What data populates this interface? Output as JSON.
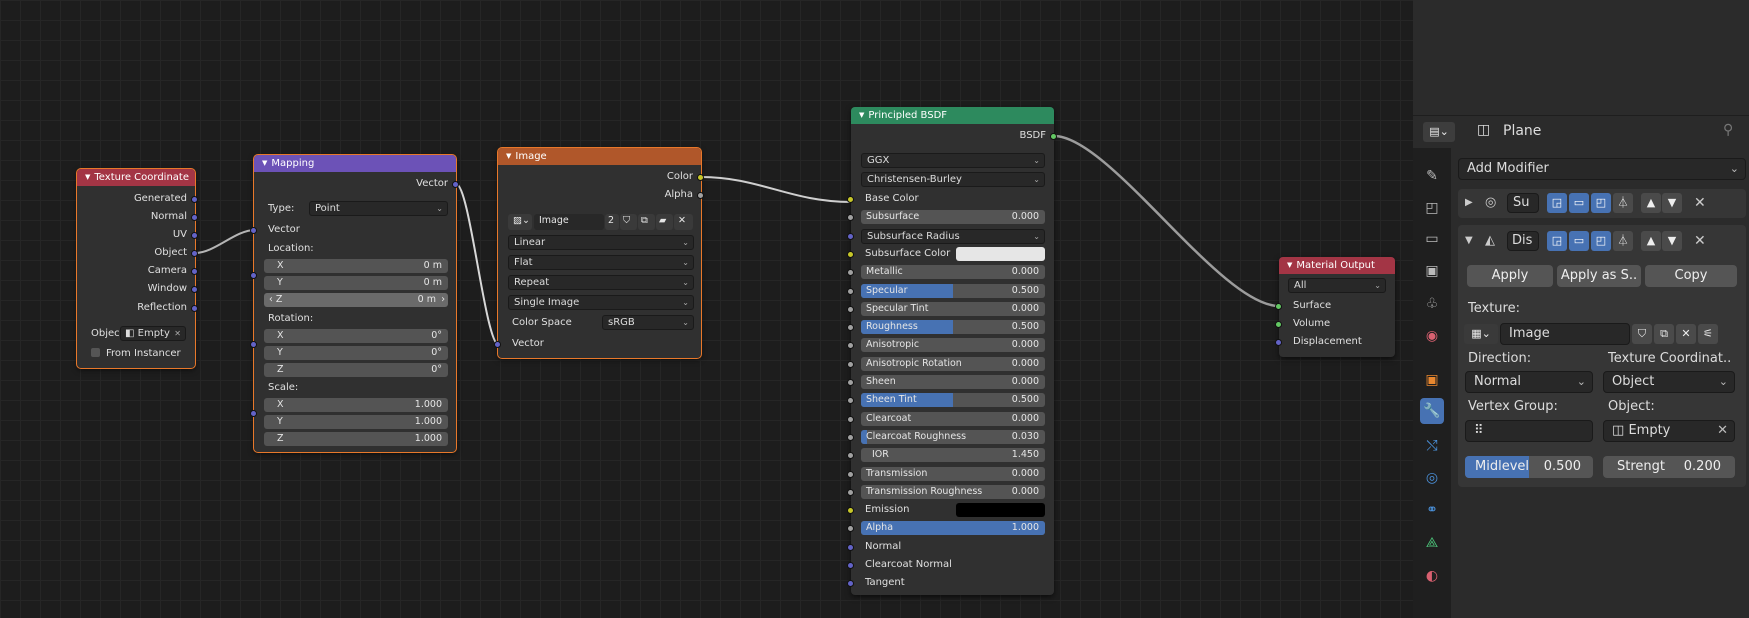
{
  "nodes": {
    "texcoord": {
      "title": "Texture Coordinate",
      "outputs": [
        "Generated",
        "Normal",
        "UV",
        "Object",
        "Camera",
        "Window",
        "Reflection"
      ],
      "object_label": "Objec",
      "object_value": "Empty",
      "from_instancer": "From Instancer"
    },
    "mapping": {
      "title": "Mapping",
      "output": "Vector",
      "type_label": "Type:",
      "type_value": "Point",
      "vector": "Vector",
      "location": "Location:",
      "rotation": "Rotation:",
      "scale": "Scale:",
      "loc": [
        {
          "a": "X",
          "v": "0 m"
        },
        {
          "a": "Y",
          "v": "0 m"
        },
        {
          "a": "Z",
          "v": "0 m"
        }
      ],
      "rot": [
        {
          "a": "X",
          "v": "0°"
        },
        {
          "a": "Y",
          "v": "0°"
        },
        {
          "a": "Z",
          "v": "0°"
        }
      ],
      "scl": [
        {
          "a": "X",
          "v": "1.000"
        },
        {
          "a": "Y",
          "v": "1.000"
        },
        {
          "a": "Z",
          "v": "1.000"
        }
      ]
    },
    "image": {
      "title": "Image",
      "out_color": "Color",
      "out_alpha": "Alpha",
      "image_name": "Image",
      "users": "2",
      "interp": "Linear",
      "proj": "Flat",
      "ext": "Repeat",
      "source": "Single Image",
      "cs_label": "Color Space",
      "cs_value": "sRGB",
      "in_vector": "Vector"
    },
    "bsdf": {
      "title": "Principled BSDF",
      "output": "BSDF",
      "distribution": "GGX",
      "subsurface_method": "Christensen-Burley",
      "inputs": [
        {
          "label": "Base Color",
          "kind": "plain"
        },
        {
          "label": "Subsurface",
          "value": "0.000",
          "kind": "num"
        },
        {
          "label": "Subsurface Radius",
          "kind": "dd"
        },
        {
          "label": "Subsurface Color",
          "kind": "color",
          "color": "#e6e6e6"
        },
        {
          "label": "Metallic",
          "value": "0.000",
          "kind": "num"
        },
        {
          "label": "Specular",
          "value": "0.500",
          "kind": "num",
          "fill": 0.5
        },
        {
          "label": "Specular Tint",
          "value": "0.000",
          "kind": "num"
        },
        {
          "label": "Roughness",
          "value": "0.500",
          "kind": "num",
          "fill": 0.5
        },
        {
          "label": "Anisotropic",
          "value": "0.000",
          "kind": "num"
        },
        {
          "label": "Anisotropic Rotation",
          "value": "0.000",
          "kind": "num"
        },
        {
          "label": "Sheen",
          "value": "0.000",
          "kind": "num"
        },
        {
          "label": "Sheen Tint",
          "value": "0.500",
          "kind": "num",
          "fill": 0.5
        },
        {
          "label": "Clearcoat",
          "value": "0.000",
          "kind": "num"
        },
        {
          "label": "Clearcoat Roughness",
          "value": "0.030",
          "kind": "num",
          "fill": 0.03
        },
        {
          "label": "IOR",
          "value": "1.450",
          "kind": "num"
        },
        {
          "label": "Transmission",
          "value": "0.000",
          "kind": "num"
        },
        {
          "label": "Transmission Roughness",
          "value": "0.000",
          "kind": "num"
        },
        {
          "label": "Emission",
          "kind": "color",
          "color": "#000000"
        },
        {
          "label": "Alpha",
          "value": "1.000",
          "kind": "num",
          "fill": 1.0
        },
        {
          "label": "Normal",
          "kind": "plain"
        },
        {
          "label": "Clearcoat Normal",
          "kind": "plain"
        },
        {
          "label": "Tangent",
          "kind": "plain"
        }
      ]
    },
    "output": {
      "title": "Material Output",
      "target": "All",
      "inputs": [
        "Surface",
        "Volume",
        "Displacement"
      ]
    }
  },
  "properties": {
    "object_name": "Plane",
    "add_modifier": "Add Modifier",
    "mod1_name": "Su",
    "mod2_name": "Dis",
    "apply": "Apply",
    "apply_as": "Apply as S..",
    "copy": "Copy",
    "texture_label": "Texture:",
    "texture_value": "Image",
    "direction_label": "Direction:",
    "direction_value": "Normal",
    "texcoord_label": "Texture Coordinat..",
    "texcoord_value": "Object",
    "vgroup_label": "Vertex Group:",
    "object_label": "Object:",
    "object_value": "Empty",
    "midlevel_label": "Midlevel",
    "midlevel_value": "0.500",
    "midlevel_fill": 0.5,
    "strength_label": "Strengt",
    "strength_value": "0.200"
  },
  "colors": {
    "accent": "#4772b3",
    "input_header": "#a33545",
    "vector_header": "#6c52b7",
    "texture_header": "#b0572a",
    "shader_header": "#2d8a5e",
    "output_header": "#a33545",
    "selection": "#e8782a"
  }
}
